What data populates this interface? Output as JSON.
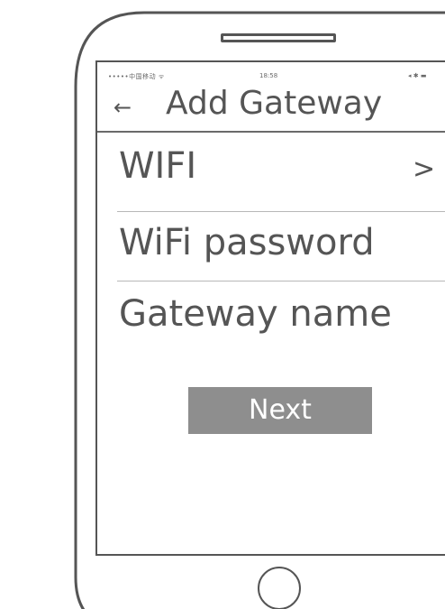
{
  "status_bar": {
    "carrier": "•••••中国移动 ᯤ",
    "time": "18:58",
    "icons": "◂ ✱ ▬"
  },
  "nav": {
    "back_icon": "←",
    "title": "Add Gateway"
  },
  "form": {
    "rows": [
      {
        "label": "WIFI",
        "chevron": ">"
      },
      {
        "label": "WiFi password"
      },
      {
        "label": "Gateway name"
      }
    ]
  },
  "actions": {
    "next_label": "Next"
  },
  "colors": {
    "outline": "#555555",
    "text": "#555555",
    "button_fill": "#8e8e8e",
    "button_text": "#ffffff",
    "divider": "#b8b8b8"
  }
}
